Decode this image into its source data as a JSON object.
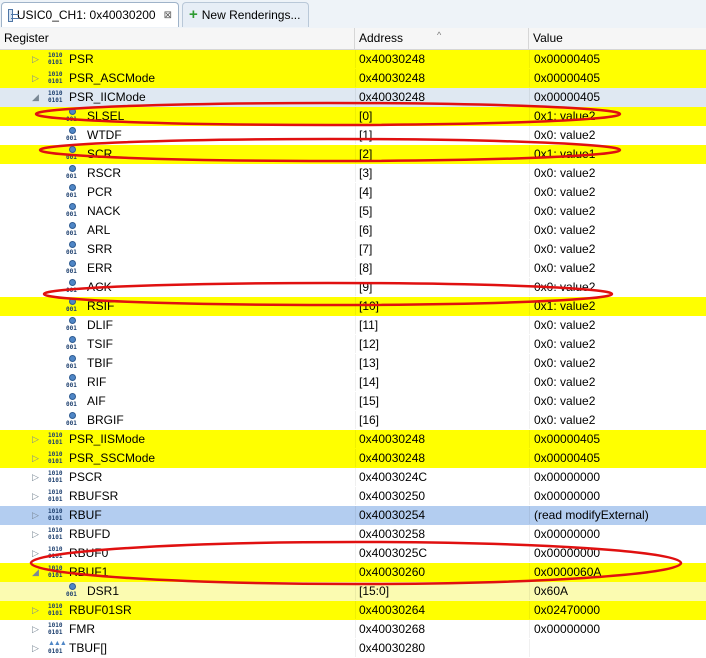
{
  "tabs": {
    "active_title": "USIC0_CH1: 0x40030200",
    "close_symbol": "⊠",
    "new_renderings": "New Renderings..."
  },
  "columns": {
    "register": "Register",
    "address": "Address",
    "value": "Value"
  },
  "rows": [
    {
      "name": "PSR",
      "address": "0x40030248",
      "value": "0x00000405",
      "kind": "register",
      "level": 0,
      "expander": "collapsed",
      "highlight": "yellow"
    },
    {
      "name": "PSR_ASCMode",
      "address": "0x40030248",
      "value": "0x00000405",
      "kind": "register",
      "level": 0,
      "expander": "collapsed",
      "highlight": "yellow"
    },
    {
      "name": "PSR_IICMode",
      "address": "0x40030248",
      "value": "0x00000405",
      "kind": "register",
      "level": 0,
      "expander": "expanded",
      "highlight": "selected"
    },
    {
      "name": "SLSEL",
      "address": "[0]",
      "value": "0x1: value2",
      "kind": "field",
      "level": 1,
      "expander": "none",
      "highlight": "yellow"
    },
    {
      "name": "WTDF",
      "address": "[1]",
      "value": "0x0: value2",
      "kind": "field",
      "level": 1,
      "expander": "none",
      "highlight": "none"
    },
    {
      "name": "SCR",
      "address": "[2]",
      "value": "0x1: value1",
      "kind": "field",
      "level": 1,
      "expander": "none",
      "highlight": "yellow"
    },
    {
      "name": "RSCR",
      "address": "[3]",
      "value": "0x0: value2",
      "kind": "field",
      "level": 1,
      "expander": "none",
      "highlight": "none"
    },
    {
      "name": "PCR",
      "address": "[4]",
      "value": "0x0: value2",
      "kind": "field",
      "level": 1,
      "expander": "none",
      "highlight": "none"
    },
    {
      "name": "NACK",
      "address": "[5]",
      "value": "0x0: value2",
      "kind": "field",
      "level": 1,
      "expander": "none",
      "highlight": "none"
    },
    {
      "name": "ARL",
      "address": "[6]",
      "value": "0x0: value2",
      "kind": "field",
      "level": 1,
      "expander": "none",
      "highlight": "none"
    },
    {
      "name": "SRR",
      "address": "[7]",
      "value": "0x0: value2",
      "kind": "field",
      "level": 1,
      "expander": "none",
      "highlight": "none"
    },
    {
      "name": "ERR",
      "address": "[8]",
      "value": "0x0: value2",
      "kind": "field",
      "level": 1,
      "expander": "none",
      "highlight": "none"
    },
    {
      "name": "ACK",
      "address": "[9]",
      "value": "0x0: value2",
      "kind": "field",
      "level": 1,
      "expander": "none",
      "highlight": "none"
    },
    {
      "name": "RSIF",
      "address": "[10]",
      "value": "0x1: value2",
      "kind": "field",
      "level": 1,
      "expander": "none",
      "highlight": "yellow"
    },
    {
      "name": "DLIF",
      "address": "[11]",
      "value": "0x0: value2",
      "kind": "field",
      "level": 1,
      "expander": "none",
      "highlight": "none"
    },
    {
      "name": "TSIF",
      "address": "[12]",
      "value": "0x0: value2",
      "kind": "field",
      "level": 1,
      "expander": "none",
      "highlight": "none"
    },
    {
      "name": "TBIF",
      "address": "[13]",
      "value": "0x0: value2",
      "kind": "field",
      "level": 1,
      "expander": "none",
      "highlight": "none"
    },
    {
      "name": "RIF",
      "address": "[14]",
      "value": "0x0: value2",
      "kind": "field",
      "level": 1,
      "expander": "none",
      "highlight": "none"
    },
    {
      "name": "AIF",
      "address": "[15]",
      "value": "0x0: value2",
      "kind": "field",
      "level": 1,
      "expander": "none",
      "highlight": "none"
    },
    {
      "name": "BRGIF",
      "address": "[16]",
      "value": "0x0: value2",
      "kind": "field",
      "level": 1,
      "expander": "none",
      "highlight": "none"
    },
    {
      "name": "PSR_IISMode",
      "address": "0x40030248",
      "value": "0x00000405",
      "kind": "register",
      "level": 0,
      "expander": "collapsed",
      "highlight": "yellow"
    },
    {
      "name": "PSR_SSCMode",
      "address": "0x40030248",
      "value": "0x00000405",
      "kind": "register",
      "level": 0,
      "expander": "collapsed",
      "highlight": "yellow"
    },
    {
      "name": "PSCR",
      "address": "0x4003024C",
      "value": "0x00000000",
      "kind": "register",
      "level": 0,
      "expander": "collapsed",
      "highlight": "none"
    },
    {
      "name": "RBUFSR",
      "address": "0x40030250",
      "value": "0x00000000",
      "kind": "register",
      "level": 0,
      "expander": "collapsed",
      "highlight": "none"
    },
    {
      "name": "RBUF",
      "address": "0x40030254",
      "value": "(read modifyExternal)",
      "kind": "register",
      "level": 0,
      "expander": "collapsed",
      "highlight": "blue"
    },
    {
      "name": "RBUFD",
      "address": "0x40030258",
      "value": "0x00000000",
      "kind": "register",
      "level": 0,
      "expander": "collapsed",
      "highlight": "none"
    },
    {
      "name": "RBUF0",
      "address": "0x4003025C",
      "value": "0x00000000",
      "kind": "register",
      "level": 0,
      "expander": "collapsed",
      "highlight": "none"
    },
    {
      "name": "RBUF1",
      "address": "0x40030260",
      "value": "0x0000060A",
      "kind": "register",
      "level": 0,
      "expander": "expanded",
      "highlight": "yellow"
    },
    {
      "name": "DSR1",
      "address": "[15:0]",
      "value": "0x60A",
      "kind": "field",
      "level": 1,
      "expander": "none",
      "highlight": "lightyellow"
    },
    {
      "name": "RBUF01SR",
      "address": "0x40030264",
      "value": "0x02470000",
      "kind": "register",
      "level": 0,
      "expander": "collapsed",
      "highlight": "yellow"
    },
    {
      "name": "FMR",
      "address": "0x40030268",
      "value": "0x00000000",
      "kind": "register",
      "level": 0,
      "expander": "collapsed",
      "highlight": "none"
    },
    {
      "name": "TBUF[]",
      "address": "0x40030280",
      "value": "",
      "kind": "array",
      "level": 0,
      "expander": "collapsed",
      "highlight": "none"
    }
  ],
  "colors": {
    "highlight_yellow": "#ffff00",
    "highlight_lightyellow": "#fbfbb1",
    "highlight_blue": "#b3cdf0",
    "selected_row": "#dfe8f2",
    "annotation_red": "#e01010"
  }
}
